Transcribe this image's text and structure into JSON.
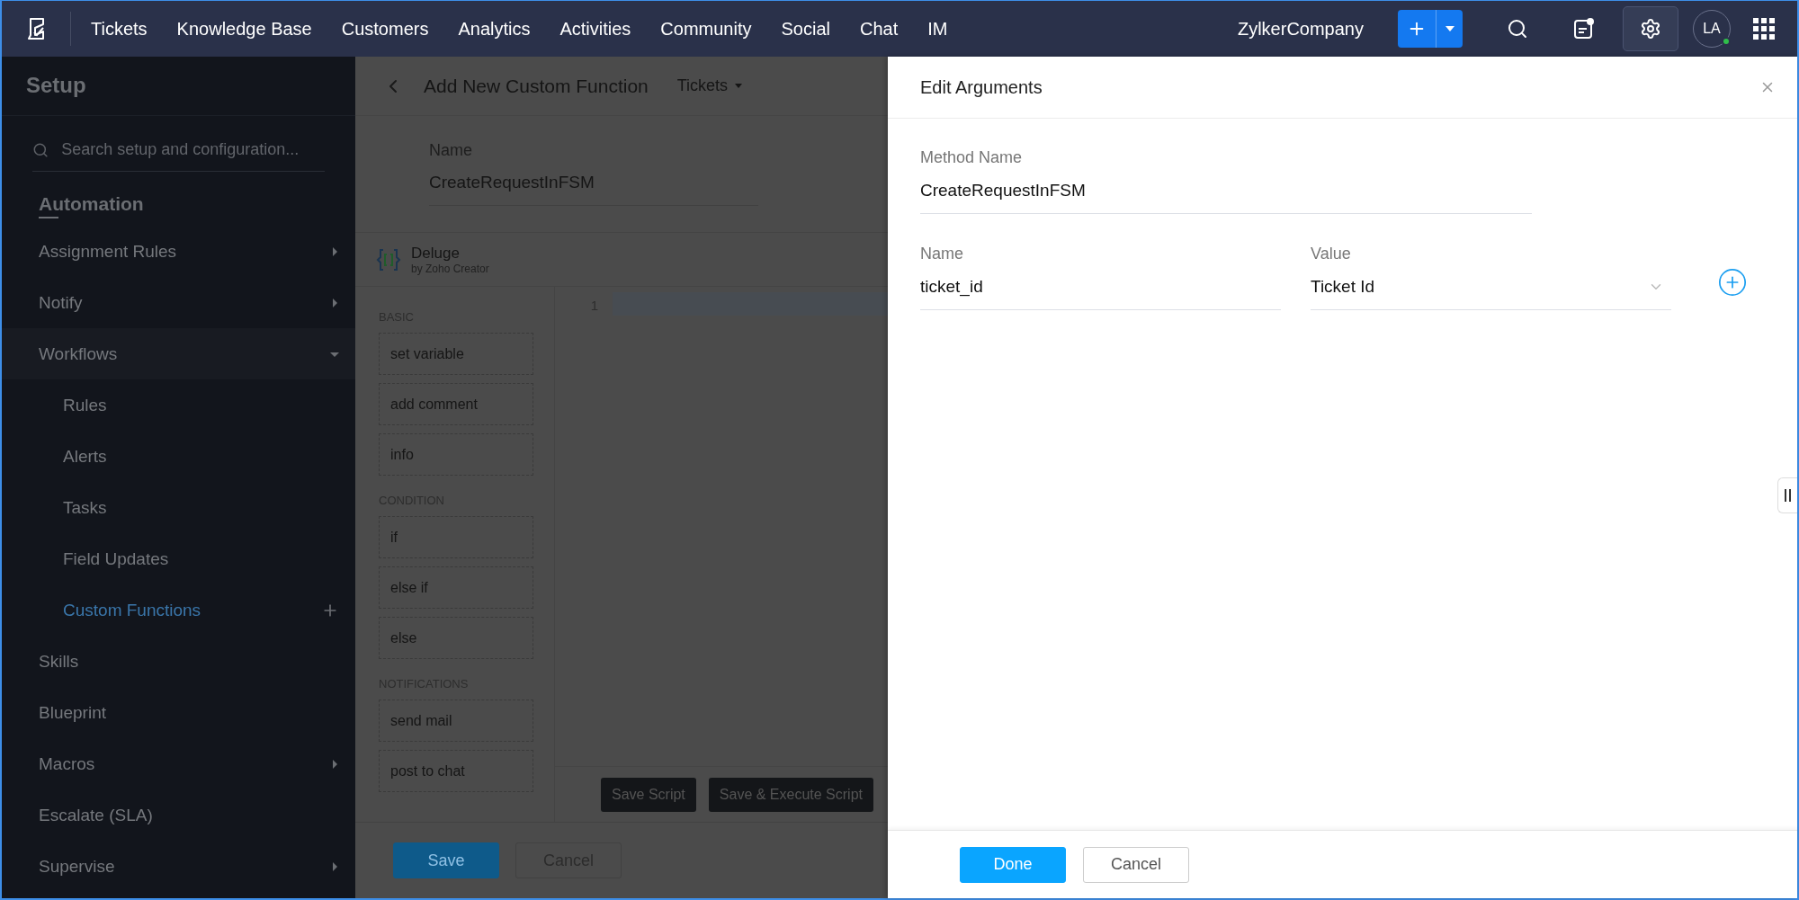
{
  "top_nav": {
    "items": [
      {
        "label": "Tickets",
        "selected": false
      },
      {
        "label": "Knowledge Base",
        "selected": false
      },
      {
        "label": "Customers",
        "selected": false
      },
      {
        "label": "Analytics",
        "selected": false
      },
      {
        "label": "Activities",
        "selected": false
      },
      {
        "label": "Community",
        "selected": false
      },
      {
        "label": "Social",
        "selected": false
      },
      {
        "label": "Chat",
        "selected": false
      },
      {
        "label": "IM",
        "selected": false
      }
    ],
    "org": "ZylkerCompany",
    "avatar": "LA",
    "online": true,
    "settings_selected": true
  },
  "sidebar": {
    "title": "Setup",
    "search": {
      "placeholder": "Search setup and configuration..."
    },
    "section": "Automation",
    "items": [
      {
        "label": "Assignment Rules",
        "selected": false,
        "expanded": false
      },
      {
        "label": "Notify",
        "selected": false,
        "expanded": false
      },
      {
        "label": "Workflows",
        "selected": false,
        "expanded": true,
        "children": [
          {
            "label": "Rules",
            "selected": false
          },
          {
            "label": "Alerts",
            "selected": false
          },
          {
            "label": "Tasks",
            "selected": false
          },
          {
            "label": "Field Updates",
            "selected": false
          },
          {
            "label": "Custom Functions",
            "selected": true,
            "addable": true
          }
        ]
      },
      {
        "label": "Skills",
        "selected": false
      },
      {
        "label": "Blueprint",
        "selected": false
      },
      {
        "label": "Macros",
        "selected": false,
        "expanded": false
      },
      {
        "label": "Escalate (SLA)",
        "selected": false
      },
      {
        "label": "Supervise",
        "selected": false,
        "expanded": false
      }
    ]
  },
  "editor": {
    "title": "Add New Custom Function",
    "module": "Tickets",
    "name_label": "Name",
    "name_value": "CreateRequestInFSM",
    "language": "Deluge",
    "language_sub": "by Zoho Creator",
    "palette": [
      {
        "heading": "BASIC",
        "items": [
          "set variable",
          "add comment",
          "info"
        ]
      },
      {
        "heading": "CONDITION",
        "items": [
          "if",
          "else if",
          "else"
        ]
      },
      {
        "heading": "NOTIFICATIONS",
        "items": [
          "send mail",
          "post to chat"
        ]
      }
    ],
    "line_numbers": [
      "1"
    ],
    "script_buttons": [
      "Save Script",
      "Save & Execute Script"
    ],
    "footer_buttons": [
      {
        "label": "Save",
        "kind": "primary"
      },
      {
        "label": "Cancel",
        "kind": "secondary"
      }
    ]
  },
  "dialog": {
    "title": "Edit Arguments",
    "method_label": "Method Name",
    "method_value": "CreateRequestInFSM",
    "columns": [
      "Name",
      "Value"
    ],
    "arguments": [
      {
        "name": "ticket_id",
        "value": "Ticket Id"
      }
    ],
    "footer_buttons": [
      {
        "label": "Done",
        "kind": "primary"
      },
      {
        "label": "Cancel",
        "kind": "secondary"
      }
    ]
  }
}
